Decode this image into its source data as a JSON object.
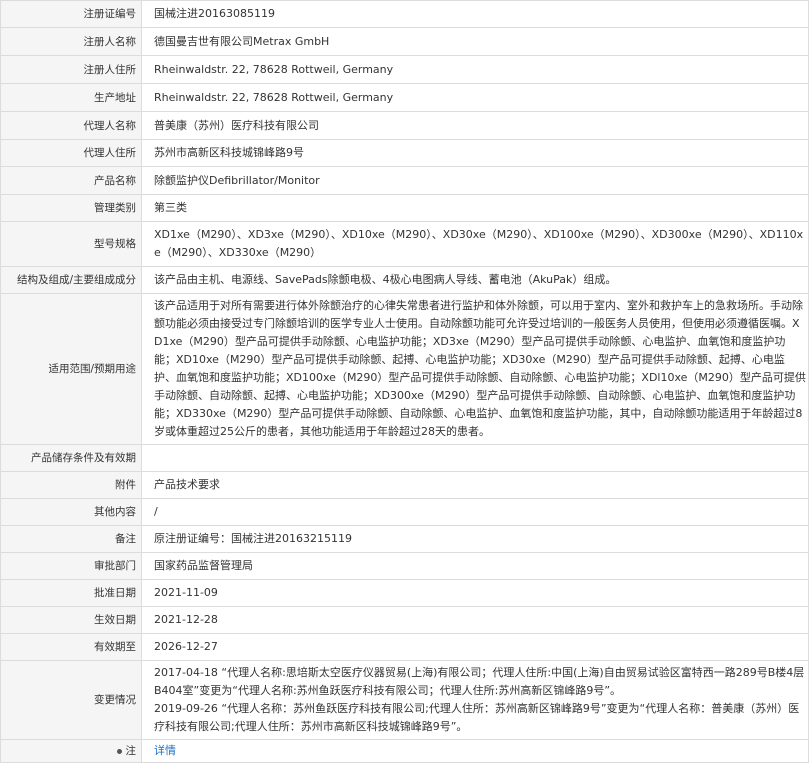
{
  "rows": [
    {
      "label": "注册证编号",
      "value": "国械注进20163085119"
    },
    {
      "label": "注册人名称",
      "value": "德国曼吉世有限公司Metrax GmbH"
    },
    {
      "label": "注册人住所",
      "value": "Rheinwaldstr. 22, 78628 Rottweil, Germany"
    },
    {
      "label": "生产地址",
      "value": "Rheinwaldstr. 22, 78628 Rottweil, Germany"
    },
    {
      "label": "代理人名称",
      "value": "普美康（苏州）医疗科技有限公司"
    },
    {
      "label": "代理人住所",
      "value": "苏州市高新区科技城锦峰路9号"
    },
    {
      "label": "产品名称",
      "value": "除颤监护仪Defibrillator/Monitor"
    },
    {
      "label": "管理类别",
      "value": "第三类"
    },
    {
      "label": "型号规格",
      "value": "XD1xe（M290）、XD3xe（M290）、XD10xe（M290）、XD30xe（M290）、XD100xe（M290）、XD300xe（M290）、XD110xe（M290）、XD330xe（M290）"
    },
    {
      "label": "结构及组成/主要组成成分",
      "value": "该产品由主机、电源线、SavePads除颤电极、4极心电图病人导线、蓄电池（AkuPak）组成。"
    },
    {
      "label": "适用范围/预期用途",
      "value": "该产品适用于对所有需要进行体外除颤治疗的心律失常患者进行监护和体外除颤，可以用于室内、室外和救护车上的急救场所。手动除颤功能必须由接受过专门除颤培训的医学专业人士使用。自动除颤功能可允许受过培训的一般医务人员使用，但使用必须遵循医嘱。XD1xe（M290）型产品可提供手动除颤、心电监护功能；XD3xe（M290）型产品可提供手动除颤、心电监护、血氧饱和度监护功能；XD10xe（M290）型产品可提供手动除颤、起搏、心电监护功能；XD30xe（M290）型产品可提供手动除颤、起搏、心电监护、血氧饱和度监护功能；XD100xe（M290）型产品可提供手动除颤、自动除颤、心电监护功能；XDl10xe（M290）型产品可提供手动除颤、自动除颤、起搏、心电监护功能；XD300xe（M290）型产品可提供手动除颤、自动除颤、心电监护、血氧饱和度监护功能；XD330xe（M290）型产品可提供手动除颤、自动除颤、心电监护、血氧饱和度监护功能，其中，自动除颤功能适用于年龄超过8岁或体重超过25公斤的患者，其他功能适用于年龄超过28天的患者。"
    },
    {
      "label": "产品储存条件及有效期",
      "value": ""
    },
    {
      "label": "附件",
      "value": "产品技术要求"
    },
    {
      "label": "其他内容",
      "value": "/"
    },
    {
      "label": "备注",
      "value": "原注册证编号：国械注进20163215119"
    },
    {
      "label": "审批部门",
      "value": "国家药品监督管理局"
    },
    {
      "label": "批准日期",
      "value": "2021-11-09"
    },
    {
      "label": "生效日期",
      "value": "2021-12-28"
    },
    {
      "label": "有效期至",
      "value": "2026-12-27"
    }
  ],
  "change": {
    "label": "变更情况",
    "entries": [
      "2017-04-18 “代理人名称:思培斯太空医疗仪器贸易(上海)有限公司；代理人住所:中国(上海)自由贸易试验区富特西一路289号B楼4层B404室”变更为“代理人名称:苏州鱼跃医疗科技有限公司；代理人住所:苏州高新区锦峰路9号”。",
      "2019-09-26 “代理人名称：苏州鱼跃医疗科技有限公司;代理人住所：苏州高新区锦峰路9号”变更为“代理人名称：普美康（苏州）医疗科技有限公司;代理人住所：苏州市高新区科技城锦峰路9号”。"
    ]
  },
  "note": {
    "label": "注",
    "link": "详情"
  }
}
